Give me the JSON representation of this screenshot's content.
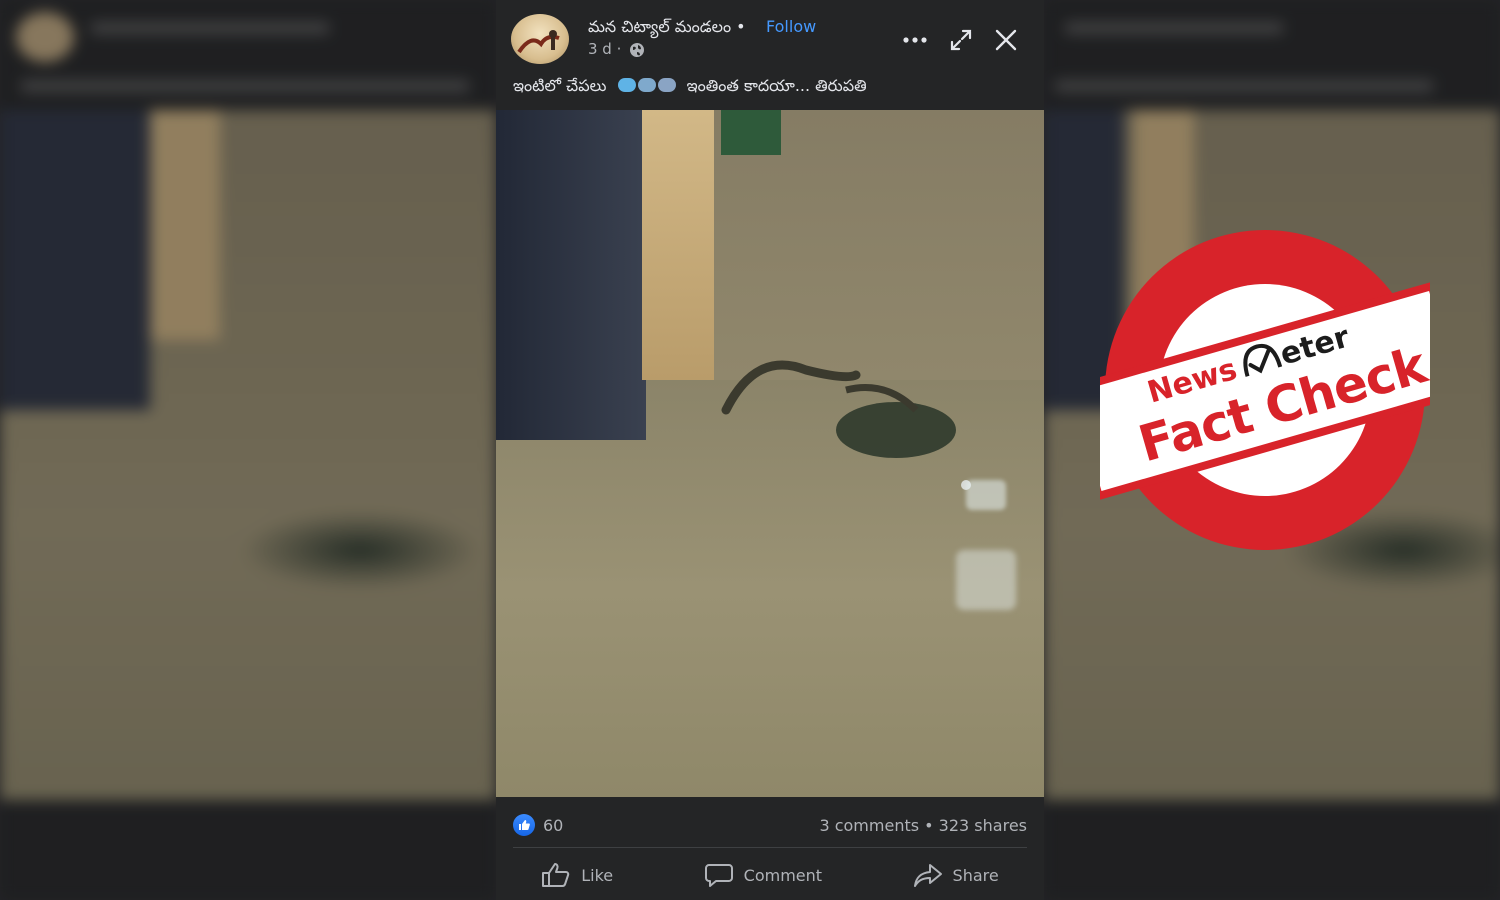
{
  "post": {
    "page_name": "మన చిట్యాల్ మండలం •",
    "follow_label": "Follow",
    "time": "3 d ·",
    "caption_start": "ఇంటిలో  చేపలు",
    "caption_end": "ఇంతింత కాదయా... తిరుపతి",
    "icons": [
      "more-icon",
      "expand-icon",
      "close-icon",
      "globe-icon"
    ]
  },
  "footer": {
    "like_count": "60",
    "stats": "3 comments • 323 shares",
    "actions": [
      {
        "label": "Like",
        "icon": "thumbs-up-icon"
      },
      {
        "label": "Comment",
        "icon": "comment-icon"
      },
      {
        "label": "Share",
        "icon": "share-icon"
      }
    ]
  },
  "stamp": {
    "brand_news": "News",
    "brand_meter": "eter",
    "text": "Fact Check",
    "color": "#d8232a"
  },
  "colors": {
    "card_bg": "#242526",
    "link_blue": "#4599ff",
    "muted_text": "#b0b3b8"
  }
}
